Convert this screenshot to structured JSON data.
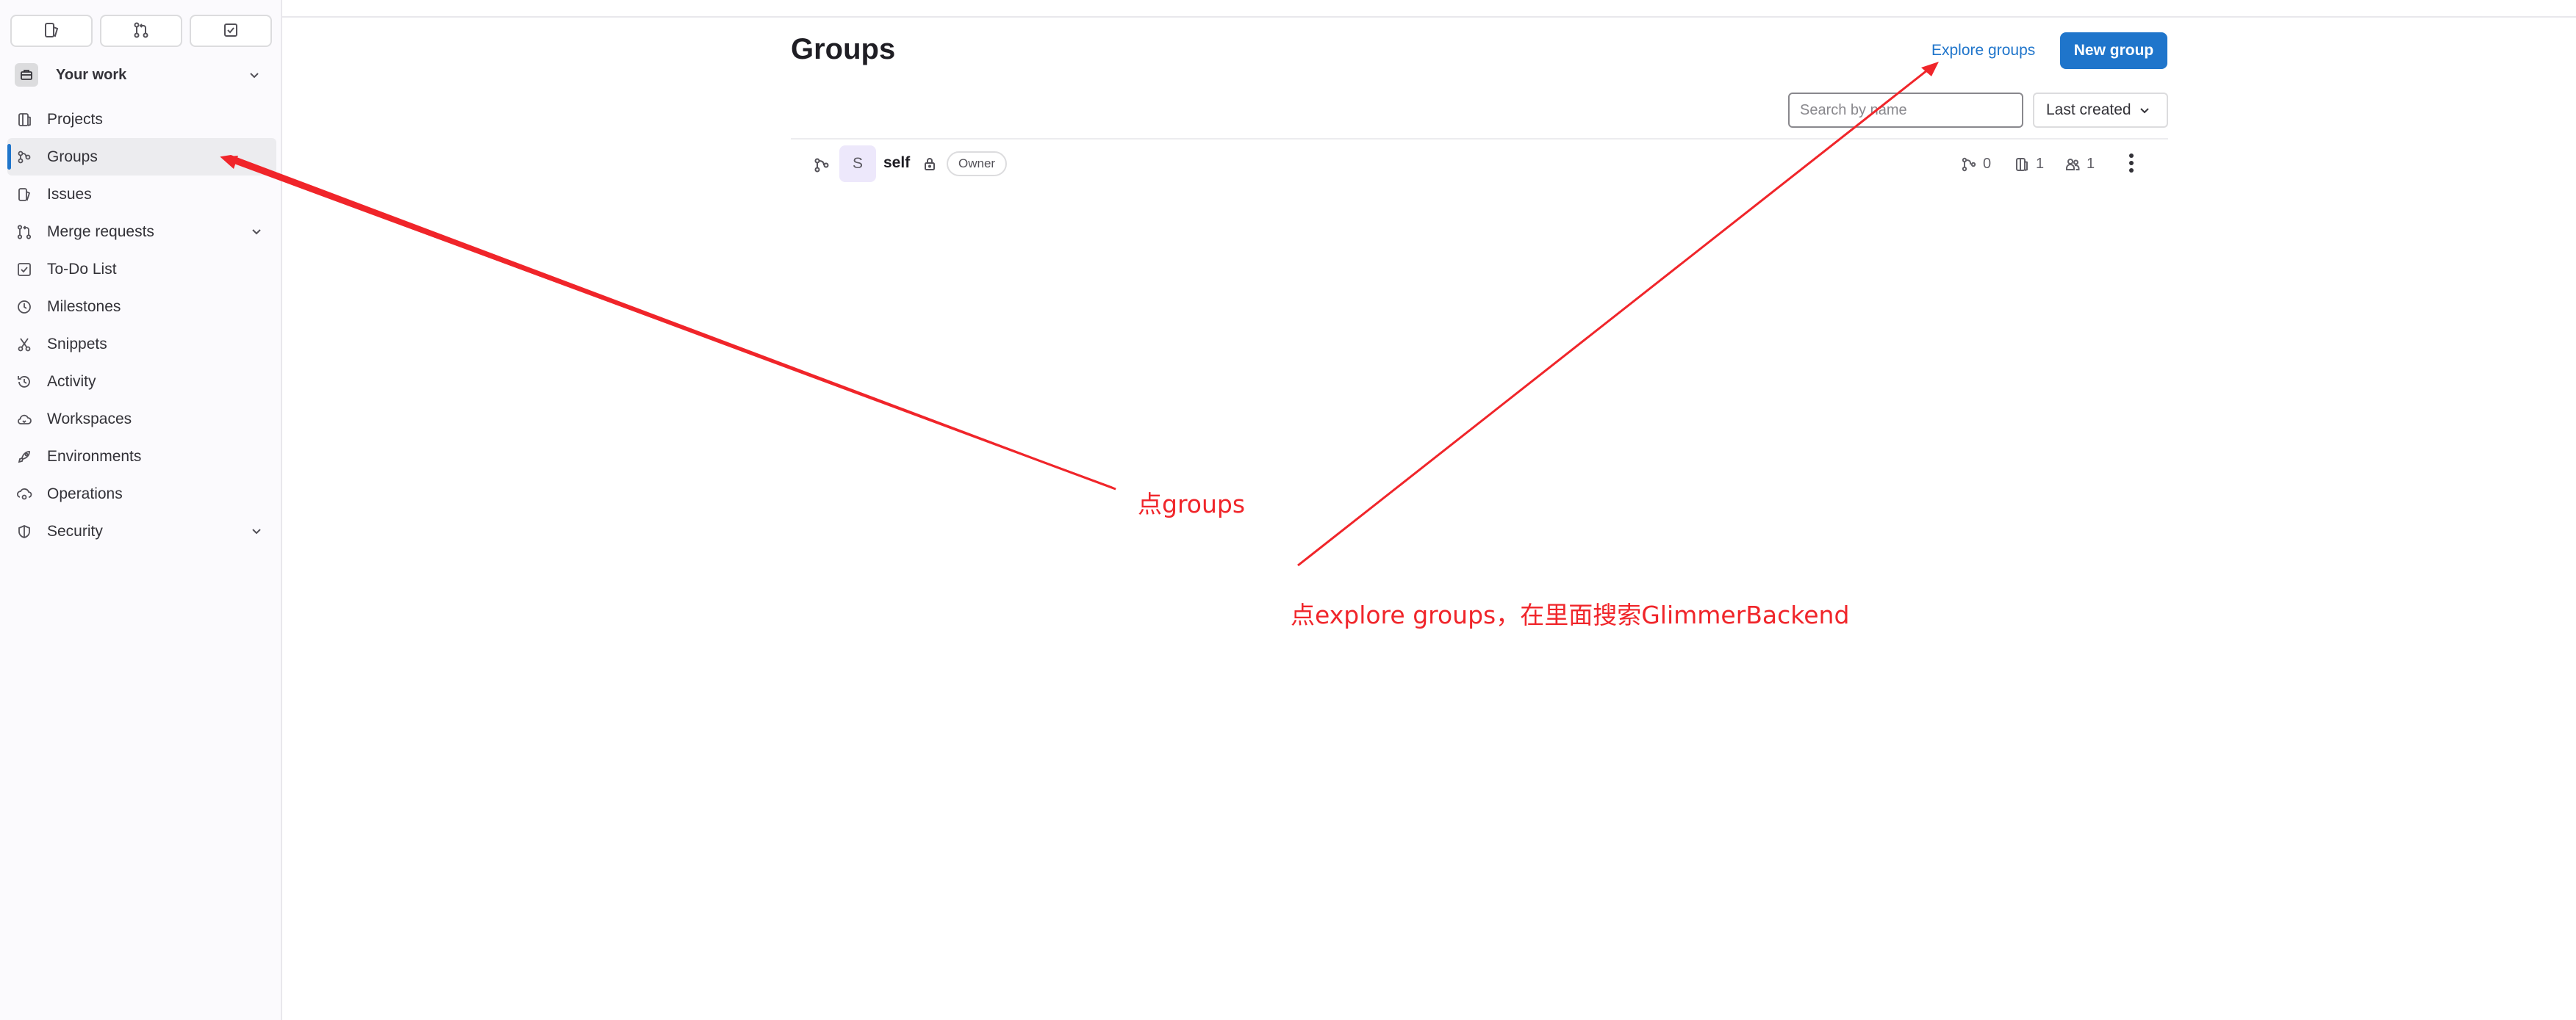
{
  "sidebar": {
    "top_buttons": [
      {
        "name": "issues-top-button",
        "icon": "issues-icon"
      },
      {
        "name": "merge-requests-top-button",
        "icon": "merge-request-icon"
      },
      {
        "name": "todo-top-button",
        "icon": "todo-icon"
      }
    ],
    "context": {
      "label": "Your work",
      "icon": "briefcase-icon"
    },
    "items": [
      {
        "label": "Projects",
        "icon": "project-icon"
      },
      {
        "label": "Groups",
        "icon": "group-icon",
        "active": true
      },
      {
        "label": "Issues",
        "icon": "issues-icon"
      },
      {
        "label": "Merge requests",
        "icon": "merge-request-icon",
        "expandable": true
      },
      {
        "label": "To-Do List",
        "icon": "todo-icon"
      },
      {
        "label": "Milestones",
        "icon": "clock-icon"
      },
      {
        "label": "Snippets",
        "icon": "scissors-icon"
      },
      {
        "label": "Activity",
        "icon": "history-icon"
      },
      {
        "label": "Workspaces",
        "icon": "cloud-icon"
      },
      {
        "label": "Environments",
        "icon": "rocket-icon"
      },
      {
        "label": "Operations",
        "icon": "cloud-gear-icon"
      },
      {
        "label": "Security",
        "icon": "shield-icon",
        "expandable": true
      }
    ]
  },
  "header": {
    "title": "Groups",
    "explore_label": "Explore groups",
    "new_group_label": "New group"
  },
  "filters": {
    "search_placeholder": "Search by name",
    "sort_label": "Last created"
  },
  "groups": [
    {
      "avatar_letter": "S",
      "name": "self",
      "visibility": "private",
      "role": "Owner",
      "subgroups": "0",
      "projects": "1",
      "members": "1"
    }
  ],
  "annotations": {
    "groups_note": "点groups",
    "explore_note": "点explore groups，在里面搜索GlimmerBackend",
    "color": "#f0252a"
  },
  "colors": {
    "accent": "#1f75cb",
    "sidebar_bg": "#fbfafd",
    "active_item_bg": "#ececef",
    "annotation": "#f0252a"
  }
}
